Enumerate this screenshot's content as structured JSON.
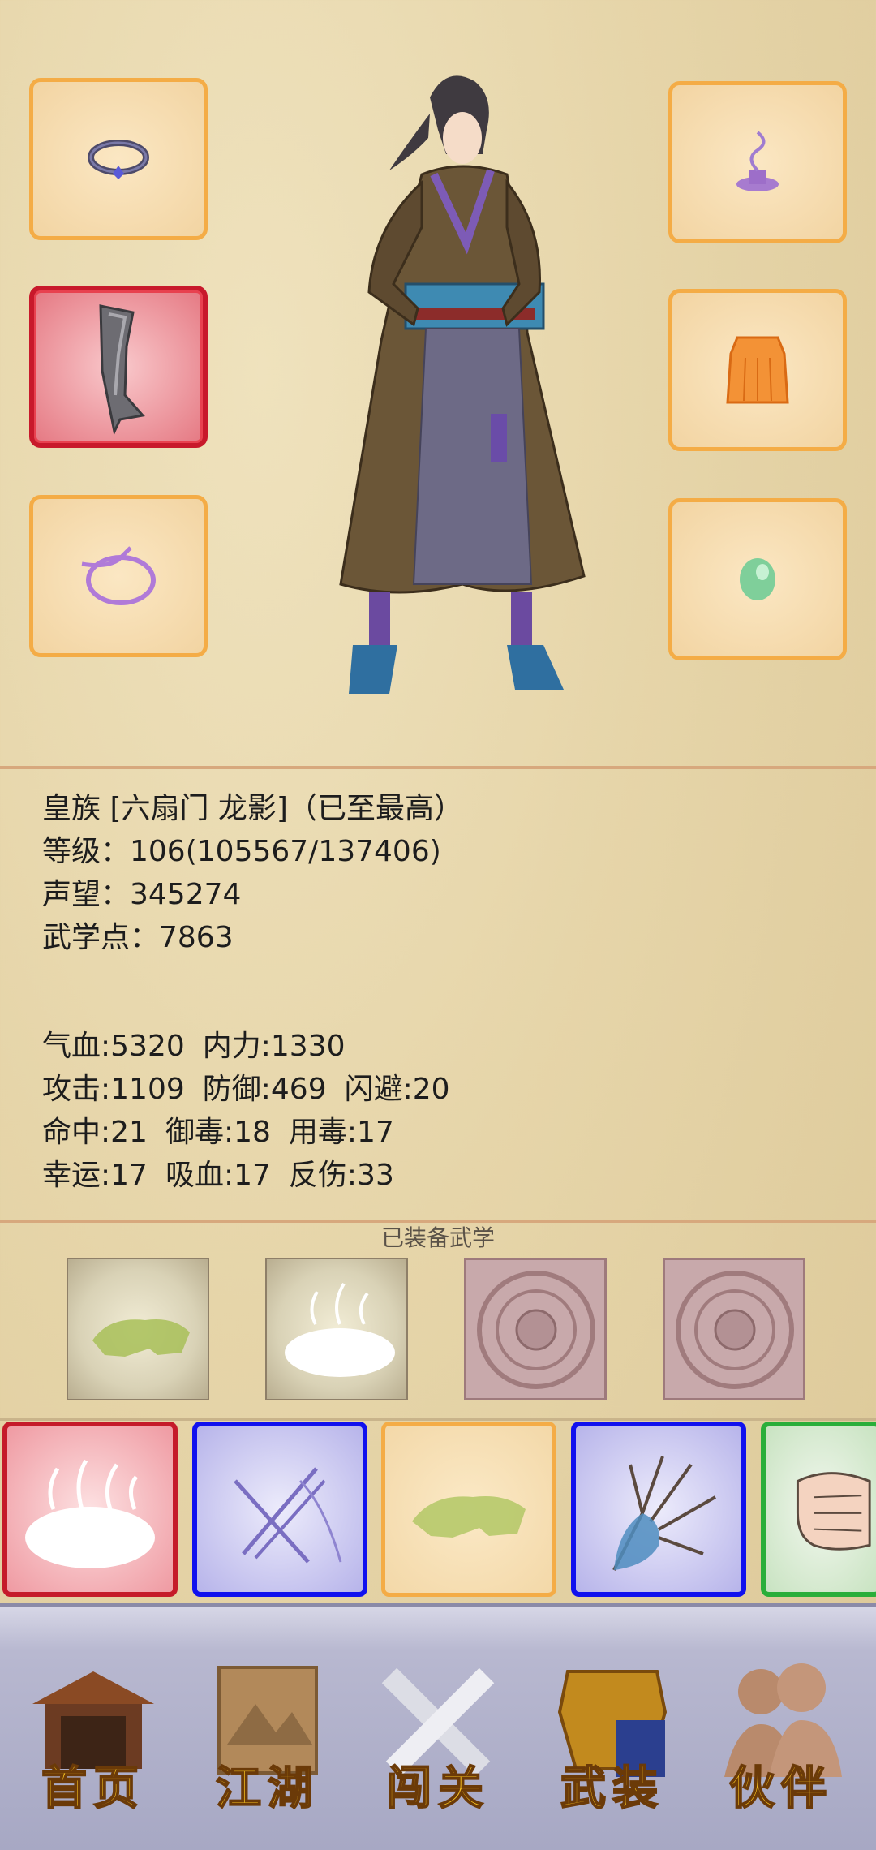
{
  "character": {
    "title": "皇族 [六扇门 龙影]（已至最高）",
    "level": "等级：106(105567/137406)",
    "prestige": "声望：345274",
    "martial_points": "武学点：7863"
  },
  "attributes": {
    "hp": "气血:5320",
    "mp": "内力:1330",
    "attack": "攻击:1109",
    "defense": "防御:469",
    "dodge": "闪避:20",
    "hit": "命中:21",
    "poison_resist": "御毒:18",
    "poison_use": "用毒:17",
    "luck": "幸运:17",
    "lifesteal": "吸血:17",
    "reflect": "反伤:33"
  },
  "equipment_slots": [
    {
      "name": "ring-icon"
    },
    {
      "name": "sword-icon",
      "highlight": "#c8192b"
    },
    {
      "name": "bracelet-icon"
    },
    {
      "name": "incense-icon"
    },
    {
      "name": "armor-icon"
    },
    {
      "name": "jade-icon"
    }
  ],
  "martial": {
    "title": "已装备武学",
    "slots": [
      "beast-scroll",
      "mist-scroll",
      "empty-seal",
      "empty-seal"
    ]
  },
  "skills": [
    {
      "name": "mist-skill",
      "border": "#c51b2a"
    },
    {
      "name": "needles-skill",
      "border": "#1111ee"
    },
    {
      "name": "beast-skill",
      "border": "#f4ac46"
    },
    {
      "name": "palm-skill",
      "border": "#1111ee"
    },
    {
      "name": "fist-skill",
      "border": "#2aae3a"
    }
  ],
  "nav": {
    "home": "首页",
    "jianghu": "江湖",
    "challenge": "闯关",
    "equip": "武装",
    "partner": "伙伴"
  }
}
